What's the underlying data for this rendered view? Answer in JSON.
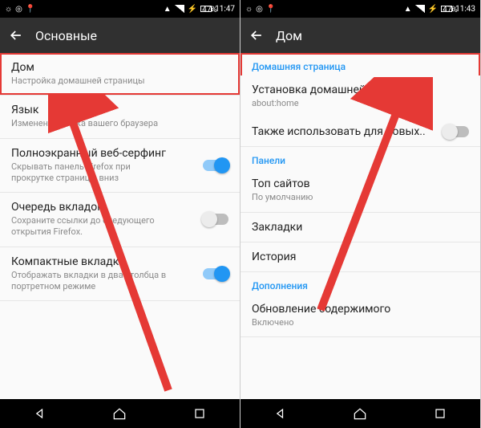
{
  "left": {
    "status": {
      "time": "11:47",
      "battery": "47%"
    },
    "appbar": {
      "title": "Основные"
    },
    "rows": [
      {
        "label": "Дом",
        "sub": "Настройка домашней страницы"
      },
      {
        "label": "Язык",
        "sub": "Изменение языка вашего браузера"
      },
      {
        "label": "Полноэкранный веб-серфинг",
        "sub": "Скрывать панель Firefox при прокрутке страницы вниз"
      },
      {
        "label": "Очередь вкладок",
        "sub": "Сохраните ссылки до следующего открытия Firefox."
      },
      {
        "label": "Компактные вкладки",
        "sub": "Отображать вкладки в два столбца в портретном режиме"
      }
    ]
  },
  "right": {
    "status": {
      "time": "11:43",
      "battery": "47%"
    },
    "appbar": {
      "title": "Дом"
    },
    "sections": {
      "s1": "Домашняя страница",
      "s2": "Панели",
      "s3": "Дополнения"
    },
    "rows": {
      "homepage": {
        "label": "Установка домашней страницы",
        "sub": "about:home"
      },
      "newtab": {
        "label": "Также использовать для новых.."
      },
      "topsites": {
        "label": "Топ сайтов",
        "sub": "По умолчанию"
      },
      "bookmarks": {
        "label": "Закладки"
      },
      "history": {
        "label": "История"
      },
      "updates": {
        "label": "Обновление содержимого",
        "sub": "Включено"
      }
    }
  }
}
